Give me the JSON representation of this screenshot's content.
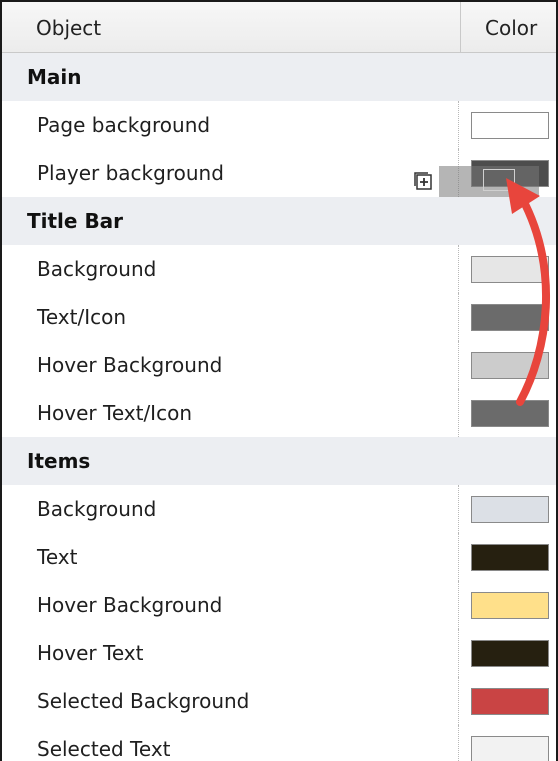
{
  "header": {
    "object_label": "Object",
    "color_label": "Color"
  },
  "sections": [
    {
      "title": "Main",
      "items": [
        {
          "label": "Page background",
          "color": "#ffffff"
        },
        {
          "label": "Player background",
          "color": "#4d4d4d"
        }
      ]
    },
    {
      "title": "Title Bar",
      "items": [
        {
          "label": "Background",
          "color": "#e6e6e6"
        },
        {
          "label": "Text/Icon",
          "color": "#6b6b6b"
        },
        {
          "label": "Hover Background",
          "color": "#cccccc"
        },
        {
          "label": "Hover Text/Icon",
          "color": "#6b6b6b"
        }
      ]
    },
    {
      "title": "Items",
      "items": [
        {
          "label": "Background",
          "color": "#dce0e6"
        },
        {
          "label": "Text",
          "color": "#262010"
        },
        {
          "label": "Hover Background",
          "color": "#ffe08a"
        },
        {
          "label": "Hover Text",
          "color": "#262010"
        },
        {
          "label": "Selected Background",
          "color": "#c94444"
        },
        {
          "label": "Selected Text",
          "color": "#f2f2f2"
        }
      ]
    }
  ],
  "annotation": {
    "arrow_color": "#e8453c",
    "drag_icon": "copy-add-icon"
  }
}
